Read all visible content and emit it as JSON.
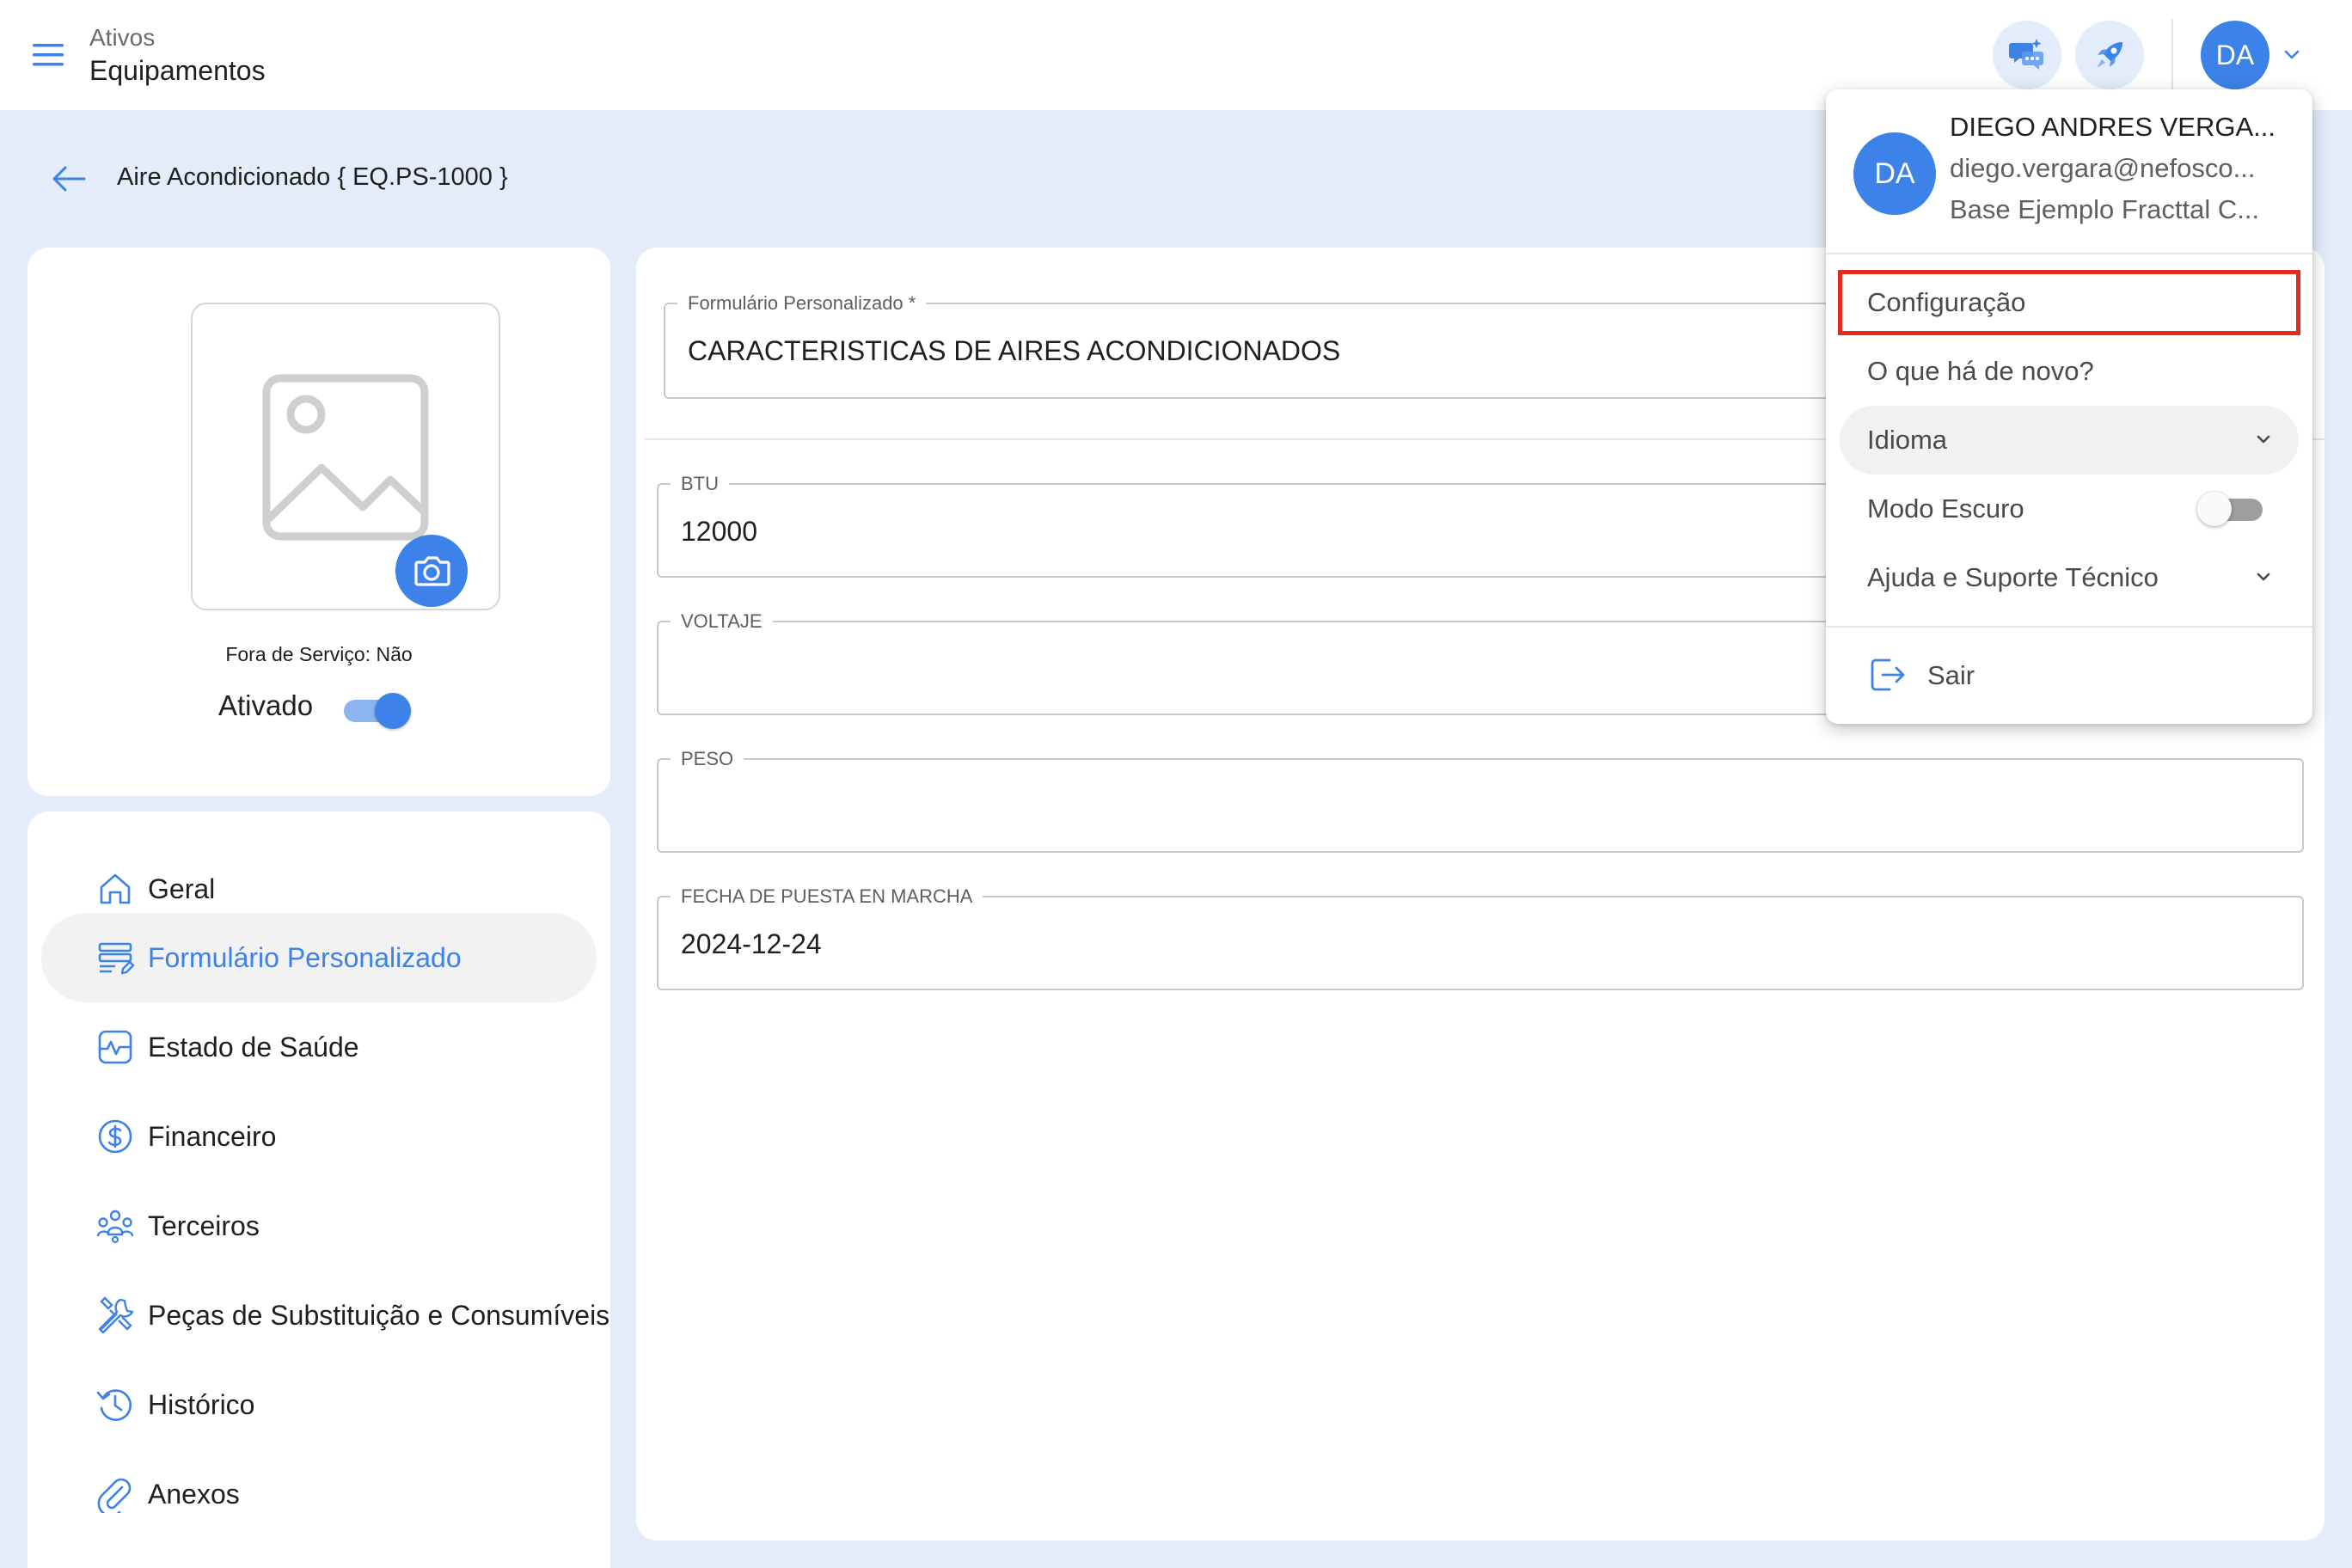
{
  "header": {
    "parent": "Ativos",
    "title": "Equipamentos",
    "avatar_initials": "DA"
  },
  "page": {
    "title": "Aire Acondicionado { EQ.PS-1000 }"
  },
  "asset_card": {
    "out_of_service": "Fora de Serviço: Não",
    "active_label": "Ativado",
    "active": true
  },
  "nav": {
    "items": [
      {
        "label": "Geral",
        "icon": "home-icon"
      },
      {
        "label": "Formulário Personalizado",
        "icon": "form-icon",
        "active": true
      },
      {
        "label": "Estado de Saúde",
        "icon": "health-icon"
      },
      {
        "label": "Financeiro",
        "icon": "dollar-icon"
      },
      {
        "label": "Terceiros",
        "icon": "people-icon"
      },
      {
        "label": "Peças de Substituição e Consumíveis",
        "icon": "tools-icon"
      },
      {
        "label": "Histórico",
        "icon": "history-icon"
      },
      {
        "label": "Anexos",
        "icon": "attachment-icon"
      }
    ]
  },
  "form": {
    "custom_form": {
      "label": "Formulário Personalizado *",
      "value": "CARACTERISTICAS DE AIRES ACONDICIONADOS"
    },
    "fields": [
      {
        "label": "BTU",
        "value": "12000"
      },
      {
        "label": "VOLTAJE",
        "value": ""
      },
      {
        "label": "PESO",
        "value": ""
      },
      {
        "label": "FECHA DE PUESTA EN MARCHA",
        "value": "2024-12-24"
      }
    ]
  },
  "user_menu": {
    "initials": "DA",
    "name": "DIEGO ANDRES VERGA...",
    "email": "diego.vergara@nefosco...",
    "company": "Base Ejemplo Fracttal C...",
    "items": {
      "settings": "Configuração",
      "whats_new": "O que há de novo?",
      "language": "Idioma",
      "dark_mode": "Modo Escuro",
      "help": "Ajuda e Suporte Técnico"
    },
    "dark_mode_on": false,
    "logout": "Sair"
  },
  "colors": {
    "accent": "#3d82e8",
    "background": "#e4ecfa",
    "highlight": "#e42a1d"
  }
}
